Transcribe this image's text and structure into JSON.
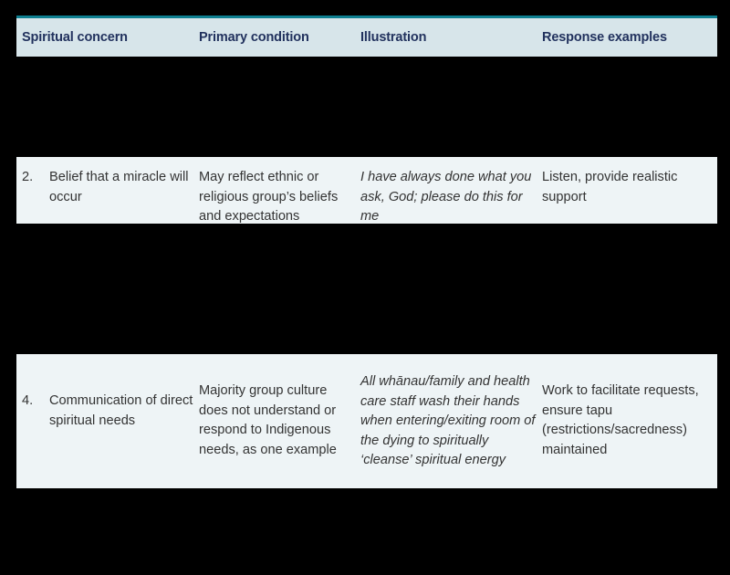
{
  "figure": {
    "background_color": "#000000",
    "header_band_color": "#d7e5ea",
    "header_rule_color": "#0e7f90",
    "row_band_color": "#eef4f6",
    "header_text_color": "#22325e",
    "body_text_color": "#333333"
  },
  "table": {
    "columns": [
      {
        "key": "concern",
        "label": "Spiritual concern"
      },
      {
        "key": "primary",
        "label": "Primary condition"
      },
      {
        "key": "illus",
        "label": "Illustration"
      },
      {
        "key": "response",
        "label": "Response examples"
      }
    ],
    "rows": [
      {
        "number": "2.",
        "concern": "Belief that a miracle will occur",
        "primary": "May reflect ethnic or religious group’s beliefs and expectations",
        "illustration": "I have always done what you ask, God; please do this for me",
        "response": "Listen, provide realistic support",
        "illustration_style": "italic"
      },
      {
        "number": "4.",
        "concern": "Communication of direct spiritual needs",
        "primary": "Majority group culture does not understand or respond to Indigenous needs, as one example",
        "illustration": "All whānau/family and health care staff wash their hands when entering/exiting room of the dying to spiritually ‘cleanse’ spiritual energy",
        "response": "Work to facilitate requests, ensure tapu (restrictions/sacredness) maintained",
        "illustration_style": "italic"
      }
    ]
  }
}
